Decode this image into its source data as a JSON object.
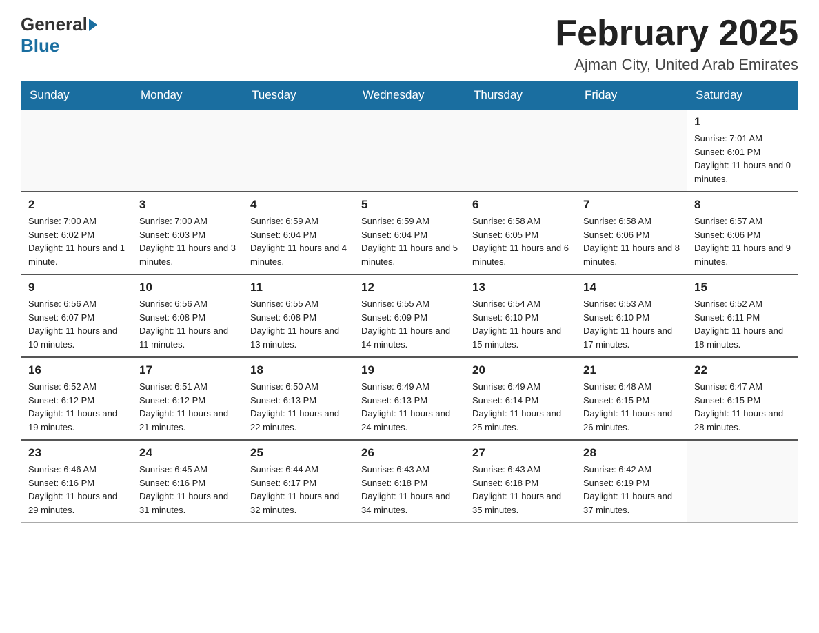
{
  "logo": {
    "general": "General",
    "blue": "Blue"
  },
  "header": {
    "month_title": "February 2025",
    "location": "Ajman City, United Arab Emirates"
  },
  "weekdays": [
    "Sunday",
    "Monday",
    "Tuesday",
    "Wednesday",
    "Thursday",
    "Friday",
    "Saturday"
  ],
  "weeks": [
    [
      {
        "day": "",
        "info": ""
      },
      {
        "day": "",
        "info": ""
      },
      {
        "day": "",
        "info": ""
      },
      {
        "day": "",
        "info": ""
      },
      {
        "day": "",
        "info": ""
      },
      {
        "day": "",
        "info": ""
      },
      {
        "day": "1",
        "info": "Sunrise: 7:01 AM\nSunset: 6:01 PM\nDaylight: 11 hours and 0 minutes."
      }
    ],
    [
      {
        "day": "2",
        "info": "Sunrise: 7:00 AM\nSunset: 6:02 PM\nDaylight: 11 hours and 1 minute."
      },
      {
        "day": "3",
        "info": "Sunrise: 7:00 AM\nSunset: 6:03 PM\nDaylight: 11 hours and 3 minutes."
      },
      {
        "day": "4",
        "info": "Sunrise: 6:59 AM\nSunset: 6:04 PM\nDaylight: 11 hours and 4 minutes."
      },
      {
        "day": "5",
        "info": "Sunrise: 6:59 AM\nSunset: 6:04 PM\nDaylight: 11 hours and 5 minutes."
      },
      {
        "day": "6",
        "info": "Sunrise: 6:58 AM\nSunset: 6:05 PM\nDaylight: 11 hours and 6 minutes."
      },
      {
        "day": "7",
        "info": "Sunrise: 6:58 AM\nSunset: 6:06 PM\nDaylight: 11 hours and 8 minutes."
      },
      {
        "day": "8",
        "info": "Sunrise: 6:57 AM\nSunset: 6:06 PM\nDaylight: 11 hours and 9 minutes."
      }
    ],
    [
      {
        "day": "9",
        "info": "Sunrise: 6:56 AM\nSunset: 6:07 PM\nDaylight: 11 hours and 10 minutes."
      },
      {
        "day": "10",
        "info": "Sunrise: 6:56 AM\nSunset: 6:08 PM\nDaylight: 11 hours and 11 minutes."
      },
      {
        "day": "11",
        "info": "Sunrise: 6:55 AM\nSunset: 6:08 PM\nDaylight: 11 hours and 13 minutes."
      },
      {
        "day": "12",
        "info": "Sunrise: 6:55 AM\nSunset: 6:09 PM\nDaylight: 11 hours and 14 minutes."
      },
      {
        "day": "13",
        "info": "Sunrise: 6:54 AM\nSunset: 6:10 PM\nDaylight: 11 hours and 15 minutes."
      },
      {
        "day": "14",
        "info": "Sunrise: 6:53 AM\nSunset: 6:10 PM\nDaylight: 11 hours and 17 minutes."
      },
      {
        "day": "15",
        "info": "Sunrise: 6:52 AM\nSunset: 6:11 PM\nDaylight: 11 hours and 18 minutes."
      }
    ],
    [
      {
        "day": "16",
        "info": "Sunrise: 6:52 AM\nSunset: 6:12 PM\nDaylight: 11 hours and 19 minutes."
      },
      {
        "day": "17",
        "info": "Sunrise: 6:51 AM\nSunset: 6:12 PM\nDaylight: 11 hours and 21 minutes."
      },
      {
        "day": "18",
        "info": "Sunrise: 6:50 AM\nSunset: 6:13 PM\nDaylight: 11 hours and 22 minutes."
      },
      {
        "day": "19",
        "info": "Sunrise: 6:49 AM\nSunset: 6:13 PM\nDaylight: 11 hours and 24 minutes."
      },
      {
        "day": "20",
        "info": "Sunrise: 6:49 AM\nSunset: 6:14 PM\nDaylight: 11 hours and 25 minutes."
      },
      {
        "day": "21",
        "info": "Sunrise: 6:48 AM\nSunset: 6:15 PM\nDaylight: 11 hours and 26 minutes."
      },
      {
        "day": "22",
        "info": "Sunrise: 6:47 AM\nSunset: 6:15 PM\nDaylight: 11 hours and 28 minutes."
      }
    ],
    [
      {
        "day": "23",
        "info": "Sunrise: 6:46 AM\nSunset: 6:16 PM\nDaylight: 11 hours and 29 minutes."
      },
      {
        "day": "24",
        "info": "Sunrise: 6:45 AM\nSunset: 6:16 PM\nDaylight: 11 hours and 31 minutes."
      },
      {
        "day": "25",
        "info": "Sunrise: 6:44 AM\nSunset: 6:17 PM\nDaylight: 11 hours and 32 minutes."
      },
      {
        "day": "26",
        "info": "Sunrise: 6:43 AM\nSunset: 6:18 PM\nDaylight: 11 hours and 34 minutes."
      },
      {
        "day": "27",
        "info": "Sunrise: 6:43 AM\nSunset: 6:18 PM\nDaylight: 11 hours and 35 minutes."
      },
      {
        "day": "28",
        "info": "Sunrise: 6:42 AM\nSunset: 6:19 PM\nDaylight: 11 hours and 37 minutes."
      },
      {
        "day": "",
        "info": ""
      }
    ]
  ]
}
